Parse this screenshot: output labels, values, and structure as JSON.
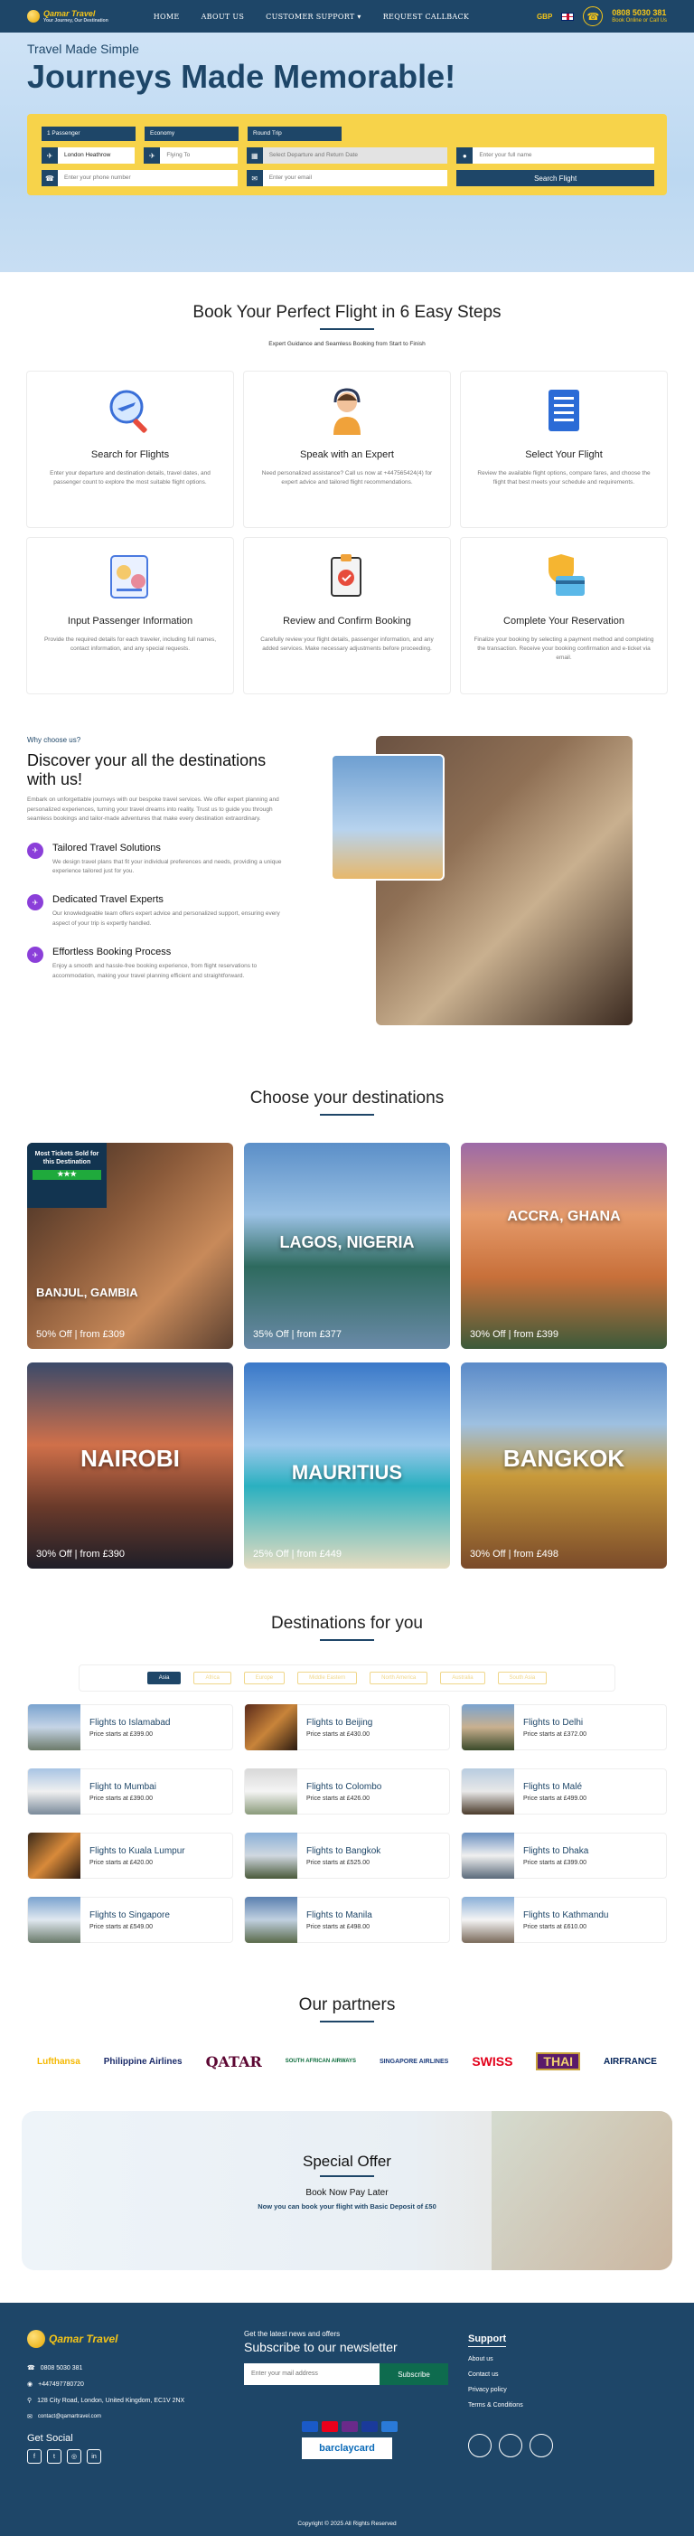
{
  "nav": {
    "logo": "Qamar Travel",
    "logo_sub": "Your Journey, Our Destination",
    "menu": [
      "HOME",
      "ABOUT US",
      "CUSTOMER SUPPORT ▾",
      "REQUEST CALLBACK"
    ],
    "currency": "GBP",
    "phone": "0808 5030 381",
    "phone_sub": "Book Online or Call Us"
  },
  "hero": {
    "subtitle": "Travel Made Simple",
    "title": "Journeys Made Memorable!",
    "selects": [
      "1 Passenger",
      "Economy",
      "Round Trip"
    ],
    "from_value": "London Heathrow",
    "to_placeholder": "Flying To",
    "date_placeholder": "Select Departure and Return Date",
    "name_placeholder": "Enter your full name",
    "phone_placeholder": "Enter your phone number",
    "email_placeholder": "Enter your email",
    "search_btn": "Search Flight"
  },
  "steps": {
    "title": "Book Your Perfect Flight in 6 Easy Steps",
    "subtitle": "Expert Guidance and Seamless Booking from Start to Finish",
    "items": [
      {
        "title": "Search for Flights",
        "text": "Enter your departure and destination details, travel dates, and passenger count to explore the most suitable flight options."
      },
      {
        "title": "Speak with an Expert",
        "text": "Need personalized assistance? Call us now at +447565424(4) for expert advice and tailored flight recommendations."
      },
      {
        "title": "Select Your Flight",
        "text": "Review the available flight options, compare fares, and choose the flight that best meets your schedule and requirements."
      },
      {
        "title": "Input Passenger Information",
        "text": "Provide the required details for each traveler, including full names, contact information, and any special requests."
      },
      {
        "title": "Review and Confirm Booking",
        "text": "Carefully review your flight details, passenger information, and any added services. Make necessary adjustments before proceeding."
      },
      {
        "title": "Complete Your Reservation",
        "text": "Finalize your booking by selecting a payment method and completing the transaction. Receive your booking confirmation and e-ticket via email."
      }
    ]
  },
  "why": {
    "tag": "Why choose us?",
    "title": "Discover your all the destinations with us!",
    "text": "Embark on unforgettable journeys with our bespoke travel services. We offer expert planning and personalized experiences, turning your travel dreams into reality. Trust us to guide you through seamless bookings and tailor-made adventures that make every destination extraordinary.",
    "features": [
      {
        "title": "Tailored Travel Solutions",
        "text": "We design travel plans that fit your individual preferences and needs, providing a unique experience tailored just for you."
      },
      {
        "title": "Dedicated Travel Experts",
        "text": "Our knowledgeable team offers expert advice and personalized support, ensuring every aspect of your trip is expertly handled."
      },
      {
        "title": "Effortless Booking Process",
        "text": "Enjoy a smooth and hassle-free booking experience, from flight reservations to accommodation, making your travel planning efficient and straightforward."
      }
    ]
  },
  "destinations": {
    "title": "Choose your destinations",
    "badge": "Most Tickets Sold for this Destination",
    "items": [
      {
        "name": "BANJUL, GAMBIA",
        "price": "50% Off | from £309",
        "bg": "linear-gradient(135deg,#3a2a22 0%,#8a5a3a 40%,#c88a5a 70%,#5b4030 100%)"
      },
      {
        "name": "LAGOS, NIGERIA",
        "price": "35% Off | from £377",
        "bg": "linear-gradient(180deg,#5b8fc8 0%,#9ac1e4 35%,#2e6a5e 60%,#6a8aa8 100%)"
      },
      {
        "name": "ACCRA, GHANA",
        "price": "30% Off | from £399",
        "bg": "linear-gradient(180deg,#9c6aa8 0%,#e59a6a 35%,#c8703a 65%,#3c5a3a 100%)"
      },
      {
        "name": "NAIROBI",
        "price": "30% Off | from £390",
        "bg": "linear-gradient(180deg,#3b4a6a 0%,#d0704a 40%,#6a3a2a 70%,#1e1e28 100%)"
      },
      {
        "name": "MAURITIUS",
        "price": "25% Off | from £449",
        "bg": "linear-gradient(180deg,#3a78c8 0%,#9cc8ec 40%,#2ab0c0 60%,#e6dcc0 100%)"
      },
      {
        "name": "BANGKOK",
        "price": "30% Off | from £498",
        "bg": "linear-gradient(180deg,#5a8ac8 0%,#9ec0e0 30%,#c89a3a 55%,#7a4a2a 100%)"
      }
    ]
  },
  "flights": {
    "title": "Destinations for you",
    "tabs": [
      "Asia",
      "Africa",
      "Europe",
      "Middle Eastern",
      "North America",
      "Australia",
      "South Asia"
    ],
    "items": [
      {
        "title": "Flights to Islamabad",
        "price": "Price starts at £399.00"
      },
      {
        "title": "Flights to Beijing",
        "price": "Price starts at £430.00"
      },
      {
        "title": "Flights to Delhi",
        "price": "Price starts at £372.00"
      },
      {
        "title": "Flight to Mumbai",
        "price": "Price starts at £390.00"
      },
      {
        "title": "Flights to Colombo",
        "price": "Price starts at £426.00"
      },
      {
        "title": "Flights to Malé",
        "price": "Price starts at £499.00"
      },
      {
        "title": "Flights to Kuala Lumpur",
        "price": "Price starts at £420.00"
      },
      {
        "title": "Flights to Bangkok",
        "price": "Price starts at £525.00"
      },
      {
        "title": "Flights to Dhaka",
        "price": "Price starts at £399.00"
      },
      {
        "title": "Flights to Singapore",
        "price": "Price starts at £549.00"
      },
      {
        "title": "Flights to Manila",
        "price": "Price starts at £498.00"
      },
      {
        "title": "Flights to Kathmandu",
        "price": "Price starts at £610.00"
      }
    ]
  },
  "partners": {
    "title": "Our partners",
    "items": [
      {
        "name": "Lufthansa",
        "color": "#f5b800"
      },
      {
        "name": "Philippine Airlines",
        "color": "#1c2c6a"
      },
      {
        "name": "QATAR",
        "color": "#5c0632"
      },
      {
        "name": "SOUTH AFRICAN AIRWAYS",
        "color": "#0b6b3a"
      },
      {
        "name": "SINGAPORE AIRLINES",
        "color": "#1c3c7c"
      },
      {
        "name": "SWISS",
        "color": "#e2001a"
      },
      {
        "name": "THAI",
        "color": "#5a1a6a"
      },
      {
        "name": "AIRFRANCE",
        "color": "#002157"
      }
    ]
  },
  "offer": {
    "title": "Special Offer",
    "text": "Book Now Pay Later",
    "small": "Now you can book your flight with Basic Deposit of £50"
  },
  "footer": {
    "logo": "Qamar Travel",
    "phone": "0808 5030 381",
    "whatsapp": "+447497780720",
    "address": "128 City Road, London, United Kingdom, EC1V 2NX",
    "email": "contact@qamartravel.com",
    "social_title": "Get Social",
    "nl_tag": "Get the latest news and offers",
    "nl_title": "Subscribe to our newsletter",
    "nl_placeholder": "Enter your mail address",
    "nl_btn": "Subscribe",
    "support_title": "Support",
    "support_links": [
      "About us",
      "Contact us",
      "Privacy policy",
      "Terms & Conditions"
    ],
    "barclay": "barclaycard",
    "copyright": "Copyright © 2025 All Rights Reserved"
  }
}
